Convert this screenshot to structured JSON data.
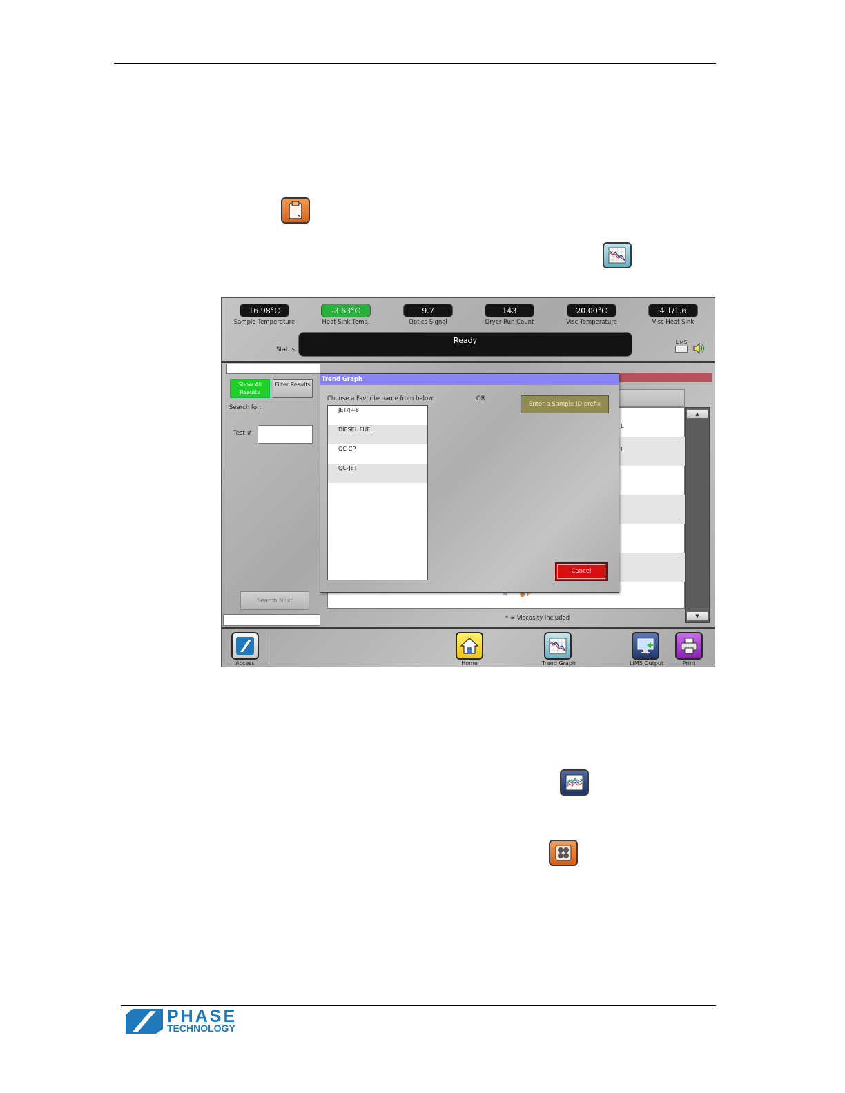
{
  "screen": {
    "readouts": [
      {
        "value": "16.98°C",
        "label": "Sample Temperature",
        "highlight": false
      },
      {
        "value": "-3.63°C",
        "label": "Heat Sink Temp.",
        "highlight": true
      },
      {
        "value": "9.7",
        "label": "Optics Signal",
        "highlight": false
      },
      {
        "value": "143",
        "label": "Dryer Run Count",
        "highlight": false
      },
      {
        "value": "20.00°C",
        "label": "Visc Temperature",
        "highlight": false
      },
      {
        "value": "4.1/1.6",
        "label": "Visc Heat Sink",
        "highlight": false
      }
    ],
    "status_label": "Status",
    "status_text": "Ready",
    "lims_badge": "LIMS",
    "left_panel": {
      "show_all": "Show All Results",
      "filter": "Filter Results",
      "search_for": "Search for:",
      "test_label": "Test #",
      "search_next": "Search Next"
    },
    "results": {
      "row_fragments": [
        "L",
        "L"
      ],
      "viscosity_note": "* = Viscosity included",
      "scroll_up": "▲",
      "scroll_down": "▼"
    },
    "dialog": {
      "title": "Trend Graph",
      "choose": "Choose a Favorite name from below:",
      "or": "OR",
      "prefix_button": "Enter a Sample ID prefix",
      "favorites": [
        "JET/JP-8",
        "DIESEL FUEL",
        "QC-CP",
        "QC-JET"
      ],
      "cancel": "Cancel"
    },
    "toolbar": {
      "access": "Access",
      "home": "Home",
      "trend": "Trend Graph",
      "lims": "LIMS Output",
      "print": "Print"
    }
  },
  "colors": {
    "dialog_title": "#8a84f2",
    "show_all_active": "#1fcf2a",
    "cancel": "#d70f0f",
    "prefix_button": "#908b50",
    "heat_sink_ok": "#2ab13c",
    "brand_blue": "#1f78b9"
  },
  "icons": [
    "clipboard-icon",
    "trend-graph-icon",
    "line-graph-icon",
    "grid-menu-icon"
  ],
  "footer": {
    "logo_word1": "PHASE",
    "logo_word2": "TECHNOLOGY"
  }
}
